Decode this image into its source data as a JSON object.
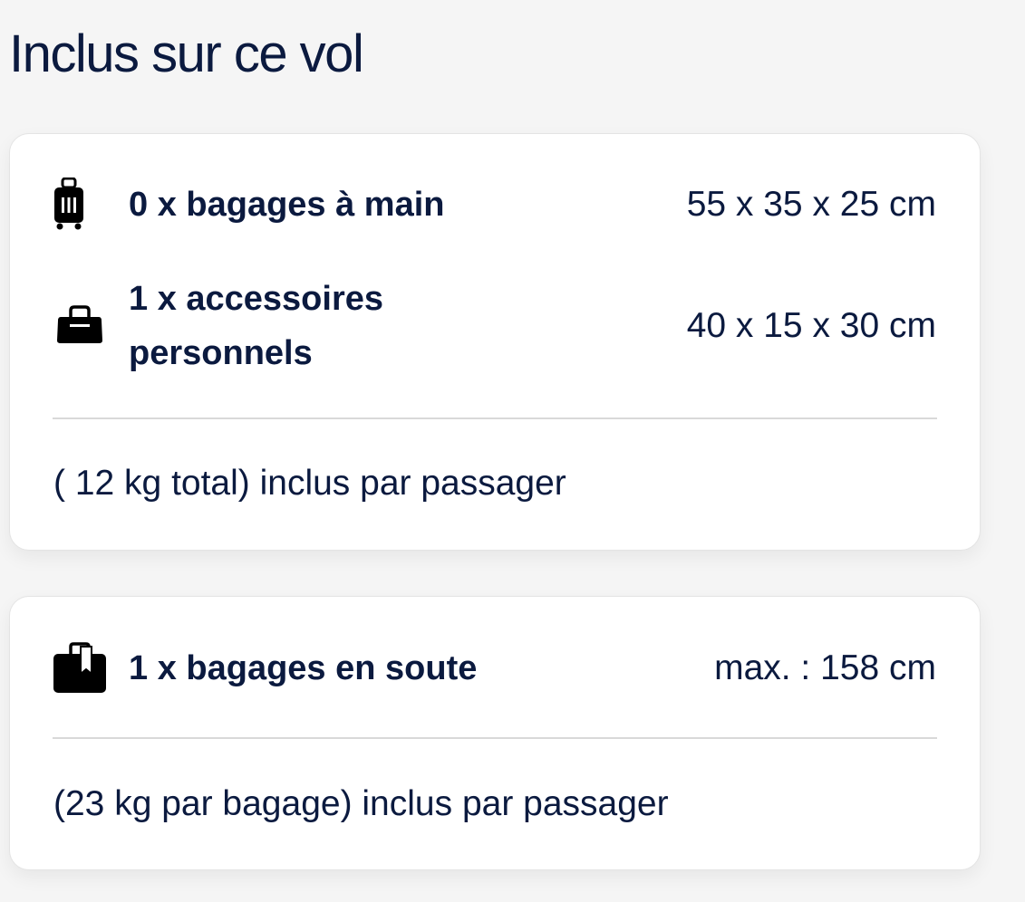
{
  "page": {
    "title": "Inclus sur ce vol"
  },
  "cabin_card": {
    "items": [
      {
        "icon": "rolling-suitcase-icon",
        "label": "0 x bagages à main",
        "dimensions": "55 x 35 x 25 cm"
      },
      {
        "icon": "handbag-icon",
        "label_line1": "1 x accessoires",
        "label_line2": "personnels",
        "dimensions": "40 x 15 x 30 cm"
      }
    ],
    "note": "( 12 kg total) inclus par passager"
  },
  "hold_card": {
    "items": [
      {
        "icon": "checked-bag-icon",
        "label": "1 x bagages en soute",
        "dimensions": "max. : 158 cm"
      }
    ],
    "note": "(23 kg par bagage) inclus par passager"
  },
  "colors": {
    "text": "#0b1a3f",
    "background": "#f5f5f5",
    "card": "#ffffff",
    "divider": "#d9d9d9"
  }
}
